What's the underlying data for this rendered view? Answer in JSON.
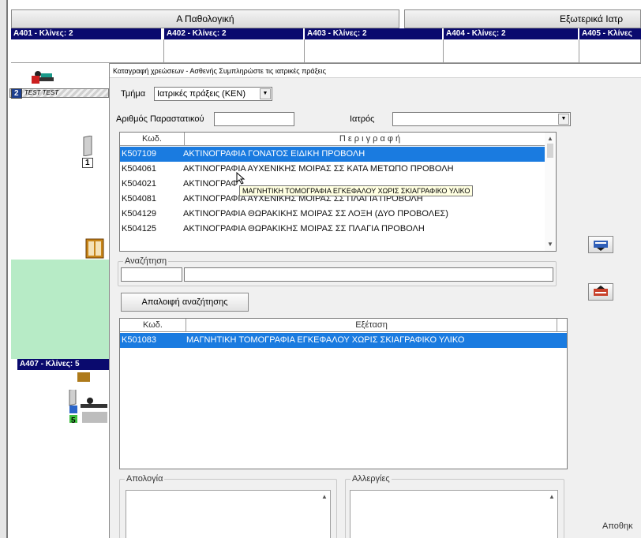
{
  "ward": {
    "tab_pathology": "Α Παθολογική",
    "tab_external": "Εξωτερικά Ιατρ",
    "rooms": [
      "Α401 - Κλίνες: 2",
      "Α402 - Κλίνες: 2",
      "Α403 - Κλίνες: 2",
      "Α404 - Κλίνες: 2",
      "Α405 - Κλίνες"
    ],
    "room_a407": "Α407 - Κλίνες: 5",
    "bed_strip_text": "TEST TEST",
    "bed_numbers": [
      "2",
      "1",
      "5"
    ]
  },
  "dialog": {
    "title": "Καταγραφή χρεώσεων - Ασθενής Συμπληρώστε τις ιατρικές πράξεις",
    "department_label": "Τμήμα",
    "department_value": "Ιατρικές πράξεις (ΚΕΝ)",
    "doc_number_label": "Αριθμός Παραστατικού",
    "doctor_label": "Ιατρός",
    "doctor_value": "",
    "procedures": {
      "header_code": "Κωδ.",
      "header_desc": "Π ε ρ ι γ ρ α φ ή",
      "rows": [
        {
          "code": "Κ507109",
          "desc": "ΑΚΤΙΝΟΓΡΑΦΙΑ ΓΟΝΑΤΟΣ ΕΙΔΙΚΗ ΠΡΟΒΟΛΗ"
        },
        {
          "code": "Κ504061",
          "desc": "ΑΚΤΙΝΟΓΡΑΦΙΑ  ΑΥΧΕΝΙΚΗΣ ΜΟΙΡΑΣ ΣΣ ΚΑΤΑ ΜΕΤΩΠΟ ΠΡΟΒΟΛΗ"
        },
        {
          "code": "Κ504021",
          "desc": "ΑΚΤΙΝΟΓΡΑΦ"
        },
        {
          "code": "Κ504081",
          "desc": "ΑΚΤΙΝΟΓΡΑΦΙΑ  ΑΥΧΕΝΙΚΗΣ ΜΟΙΡΑΣ ΣΣ ΠΛΑΓΙΑ ΠΡΟΒΟΛΗ"
        },
        {
          "code": "Κ504129",
          "desc": "ΑΚΤΙΝΟΓΡΑΦΙΑ  ΘΩΡΑΚΙΚΗΣ ΜΟΙΡΑΣ ΣΣ ΛΟΞΗ (ΔΥΟ ΠΡΟΒΟΛΕΣ)"
        },
        {
          "code": "Κ504125",
          "desc": "ΑΚΤΙΝΟΓΡΑΦΙΑ  ΘΩΡΑΚΙΚΗΣ ΜΟΙΡΑΣ ΣΣ ΠΛΑΓΙΑ ΠΡΟΒΟΛΗ"
        }
      ],
      "selected_index": 0
    },
    "tooltip": "ΜΑΓΝΗΤΙΚΗ ΤΟΜΟΓΡΑΦΙΑ  ΕΓΚΕΦΑΛΟΥ ΧΩΡΙΣ ΣΚΙΑΓΡΑΦΙΚΟ ΥΛΙΚΟ",
    "search_label": "Αναζήτηση",
    "search_code_value": "",
    "search_text_value": "",
    "clear_search_button": "Απαλοιφή αναζήτησης",
    "exams": {
      "header_code": "Κωδ.",
      "header_exam": "Εξέταση",
      "rows": [
        {
          "code": "Κ501083",
          "exam": "ΜΑΓΝΗΤΙΚΗ ΤΟΜΟΓΡΑΦΙΑ   ΕΓΚΕΦΑΛΟΥ ΧΩΡΙΣ ΣΚΙΑΓΡΑΦΙΚΟ ΥΛΙΚΟ"
        }
      ]
    },
    "justification_label": "Απολογία",
    "allergies_label": "Αλλεργίες",
    "save_partial": "Αποθηκ"
  },
  "colors": {
    "selection": "#1a7be0",
    "room_header": "#0a0a6e",
    "green_band": "#b7ebc6"
  }
}
